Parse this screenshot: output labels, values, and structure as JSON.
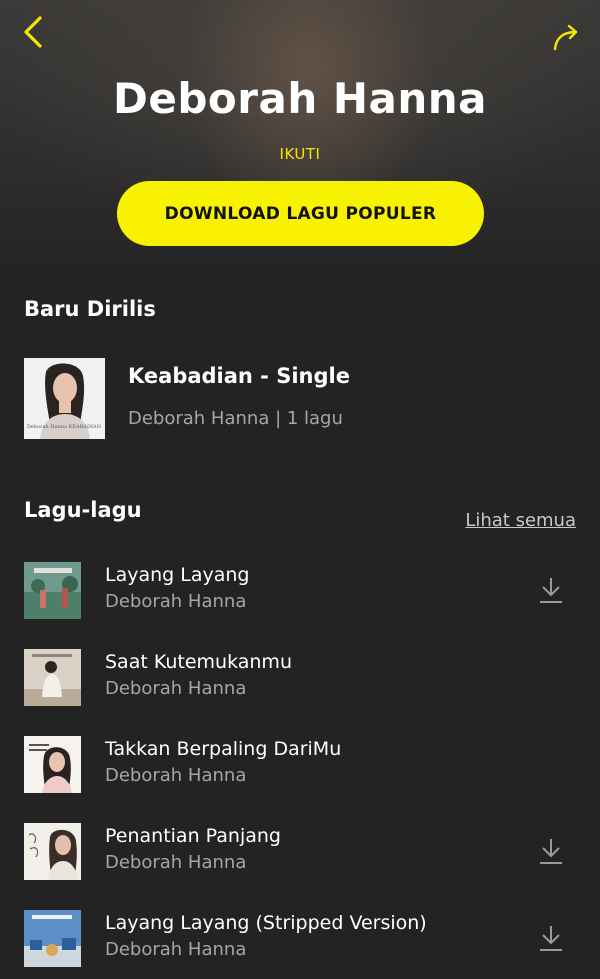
{
  "header": {
    "back_icon": "chevron-left-icon",
    "share_icon": "share-arrow-icon",
    "artist_name": "Deborah Hanna",
    "follow_label": "IKUTI",
    "download_button_label": "DOWNLOAD LAGU POPULER"
  },
  "new_release": {
    "section_title": "Baru Dirilis",
    "cover_text": "Deborah Hanna KEABADIAN",
    "title": "Keabadian - Single",
    "subtitle": "Deborah Hanna  | 1 lagu"
  },
  "songs_section": {
    "section_title": "Lagu-lagu",
    "see_all_label": "Lihat semua",
    "items": [
      {
        "title": "Layang Layang",
        "artist": "Deborah Hanna",
        "downloadable": true
      },
      {
        "title": "Saat Kutemukanmu",
        "artist": "Deborah Hanna",
        "downloadable": false
      },
      {
        "title": "Takkan Berpaling DariMu",
        "artist": "Deborah Hanna",
        "downloadable": false
      },
      {
        "title": "Penantian Panjang",
        "artist": "Deborah Hanna",
        "downloadable": true
      },
      {
        "title": "Layang Layang (Stripped Version)",
        "artist": "Deborah Hanna",
        "downloadable": true
      }
    ]
  },
  "colors": {
    "accent": "#f8f200",
    "background": "#232323",
    "secondary_text": "#a6a6a6"
  }
}
